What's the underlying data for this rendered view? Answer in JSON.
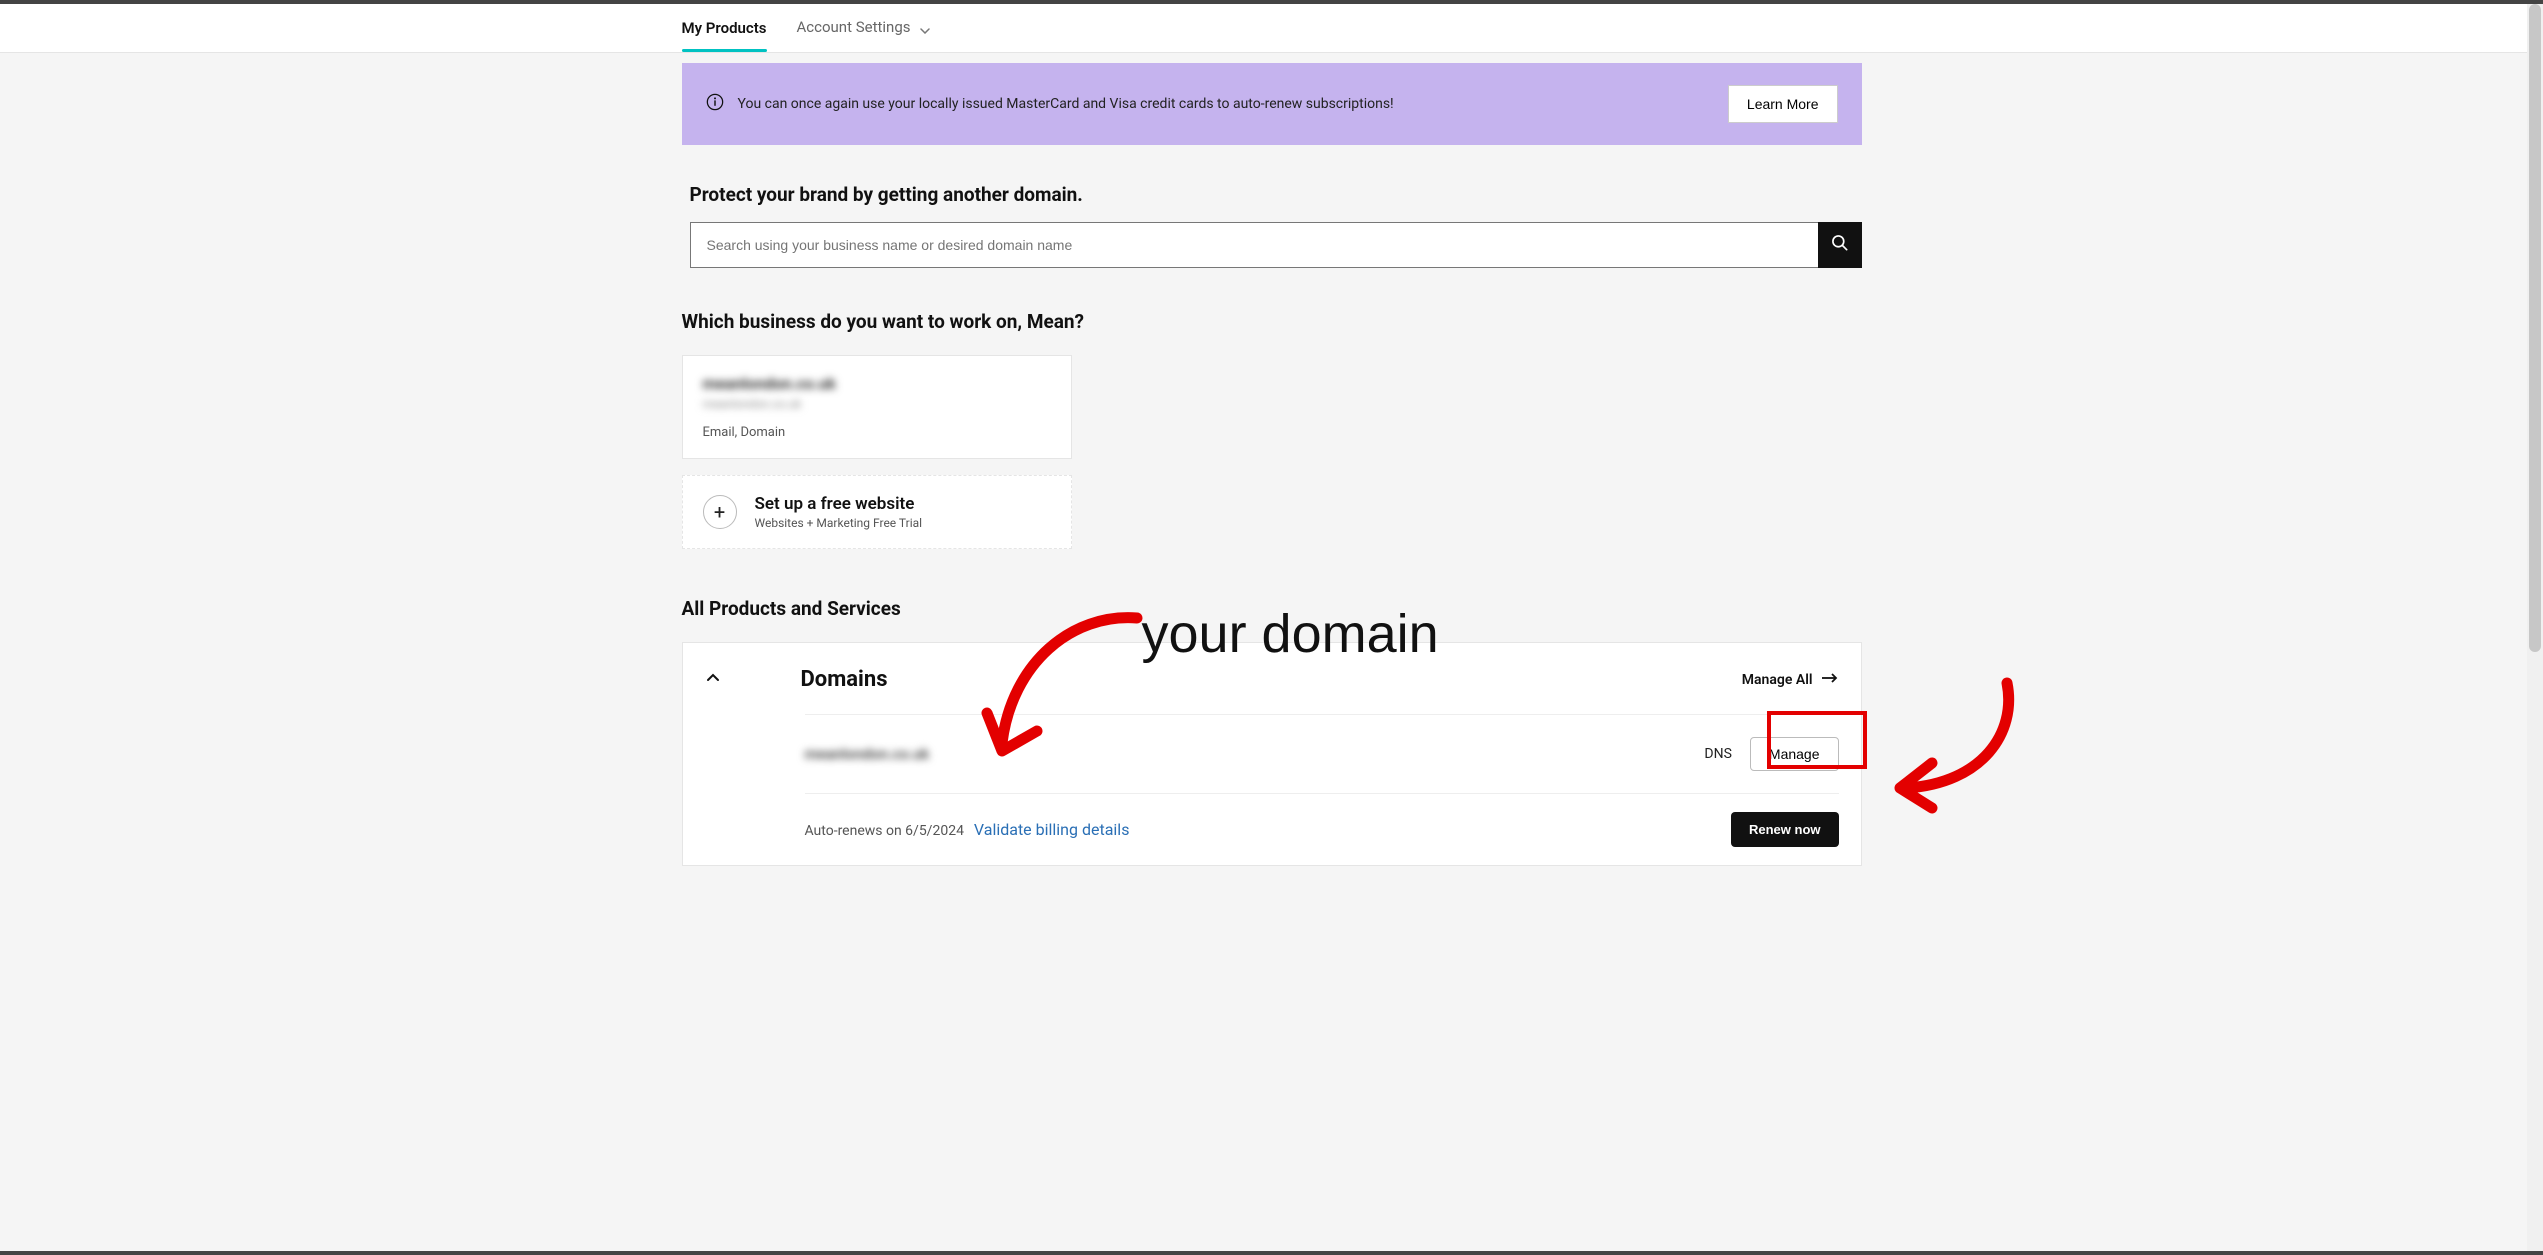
{
  "nav": {
    "my_products": "My Products",
    "account_settings": "Account Settings"
  },
  "banner": {
    "text": "You can once again use your locally issued MasterCard and Visa credit cards to auto-renew subscriptions!",
    "button": "Learn More"
  },
  "search": {
    "heading": "Protect your brand by getting another domain.",
    "placeholder": "Search using your business name or desired domain name"
  },
  "which": {
    "heading": "Which business do you want to work on, Mean?"
  },
  "business_card": {
    "title": "meanlondon.co.uk",
    "subtitle": "meanlondon.co.uk",
    "products": "Email, Domain"
  },
  "setup_card": {
    "title": "Set up a free website",
    "subtitle": "Websites + Marketing Free Trial"
  },
  "all_products_heading": "All Products and Services",
  "domains_panel": {
    "title": "Domains",
    "manage_all": "Manage All",
    "domain_name": "meanlondon.co.uk",
    "dns": "DNS",
    "manage": "Manage",
    "auto_renew": "Auto-renews on 6/5/2024",
    "validate": "Validate billing details",
    "renew": "Renew now"
  },
  "annotation": {
    "label": "your domain"
  }
}
